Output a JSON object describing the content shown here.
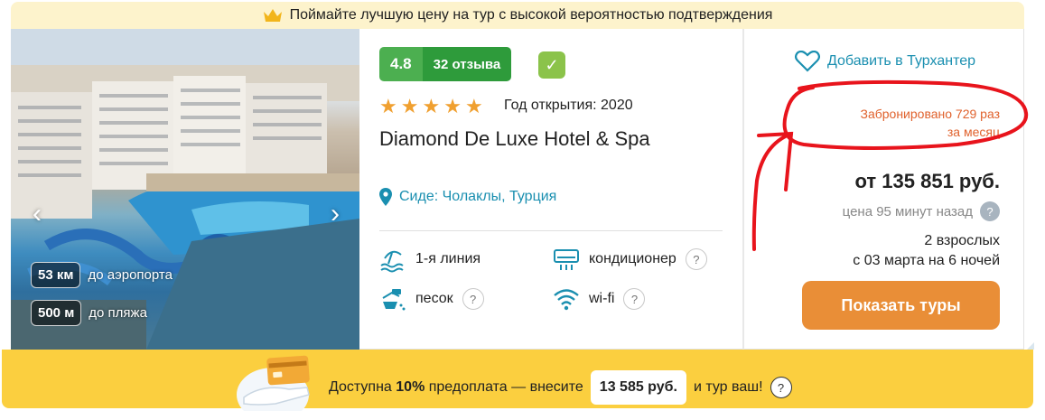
{
  "banner": {
    "text": "Поймайте лучшую цену на тур с высокой вероятностью подтверждения",
    "crown_icon": "crown-icon"
  },
  "photo": {
    "distances": [
      {
        "value": "53 км",
        "label": "до аэропорта"
      },
      {
        "value": "500 м",
        "label": "до пляжа"
      }
    ],
    "prev_icon": "chevron-left-icon",
    "next_icon": "chevron-right-icon"
  },
  "hotel": {
    "rating": "4.8",
    "reviews": "32 отзыва",
    "stars": 5,
    "opened": "Год открытия: 2020",
    "name": "Diamond De Luxe Hotel & Spa",
    "location": "Сиде: Чолаклы, Турция",
    "features": [
      {
        "label": "1-я линия",
        "icon": "beach-line-icon",
        "help": false
      },
      {
        "label": "кондиционер",
        "icon": "air-conditioner-icon",
        "help": true
      },
      {
        "label": "песок",
        "icon": "sand-icon",
        "help": true
      },
      {
        "label": "wi-fi",
        "icon": "wifi-icon",
        "help": true
      }
    ],
    "help_symbol": "?"
  },
  "offer": {
    "wishlist": "Добавить в Турхантер",
    "booked_line1": "Забронировано 729 раз",
    "booked_line2": "за месяц",
    "price": "от 135 851 руб.",
    "price_age": "цена 95 минут назад",
    "guests": "2 взрослых",
    "dates": "с 03 марта на 6 ночей",
    "button": "Показать туры"
  },
  "prepay": {
    "text_before": "Доступна ",
    "percent": "10%",
    "text_mid": " предоплата — внесите",
    "amount": "13 585 руб.",
    "text_after": "и тур ваш!"
  },
  "colors": {
    "accent": "#1a8fb0",
    "rating_green": "#4caf50",
    "button_orange": "#e98e37",
    "prepay_yellow": "#fbcf3f",
    "booked_orange": "#e0622d",
    "annotation_red": "#e8141c"
  }
}
